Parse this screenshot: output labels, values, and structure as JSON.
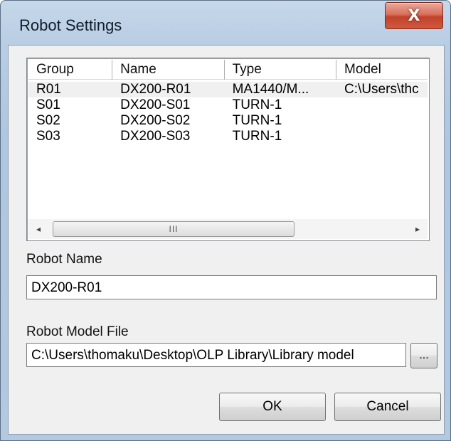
{
  "window": {
    "title": "Robot Settings",
    "close_label": "X"
  },
  "list": {
    "columns": [
      "Group",
      "Name",
      "Type",
      "Model"
    ],
    "rows": [
      {
        "group": "R01",
        "name": "DX200-R01",
        "type": "MA1440/M...",
        "model": "C:\\Users\\thc"
      },
      {
        "group": "S01",
        "name": "DX200-S01",
        "type": "TURN-1",
        "model": ""
      },
      {
        "group": "S02",
        "name": "DX200-S02",
        "type": "TURN-1",
        "model": ""
      },
      {
        "group": "S03",
        "name": "DX200-S03",
        "type": "TURN-1",
        "model": ""
      }
    ],
    "selected_row": 0,
    "scroll_left": "◂",
    "scroll_right": "▸",
    "scroll_thumb_grip": "III"
  },
  "form": {
    "robot_name_label": "Robot Name",
    "robot_name_value": "DX200-R01",
    "robot_model_label": "Robot Model File",
    "robot_model_value": "C:\\Users\\thomaku\\Desktop\\OLP Library\\Library model",
    "browse_label": "..."
  },
  "buttons": {
    "ok": "OK",
    "cancel": "Cancel"
  }
}
